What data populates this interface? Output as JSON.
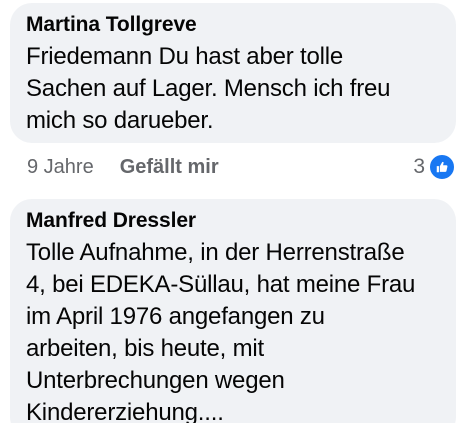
{
  "comments": [
    {
      "author": "Martina Tollgreve",
      "lines": [
        "Friedemann Du hast aber tolle",
        "Sachen auf Lager. Mensch ich freu",
        "mich so darueber."
      ],
      "time": "9 Jahre",
      "like_label": "Gefällt mir",
      "reaction_count": "3",
      "reaction_icon": "like-thumb-icon"
    },
    {
      "author": "Manfred Dressler",
      "lines": [
        "Tolle Aufnahme, in der Herrenstraße",
        "4, bei EDEKA-Süllau, hat meine Frau",
        "im April 1976 angefangen zu",
        "arbeiten, bis heute, mit",
        "Unterbrechungen wegen",
        "Kindererziehung...."
      ]
    }
  ],
  "colors": {
    "bubble_bg": "#f0f2f5",
    "text": "#050505",
    "meta_text": "#65676b",
    "like_blue": "#1877f2"
  }
}
